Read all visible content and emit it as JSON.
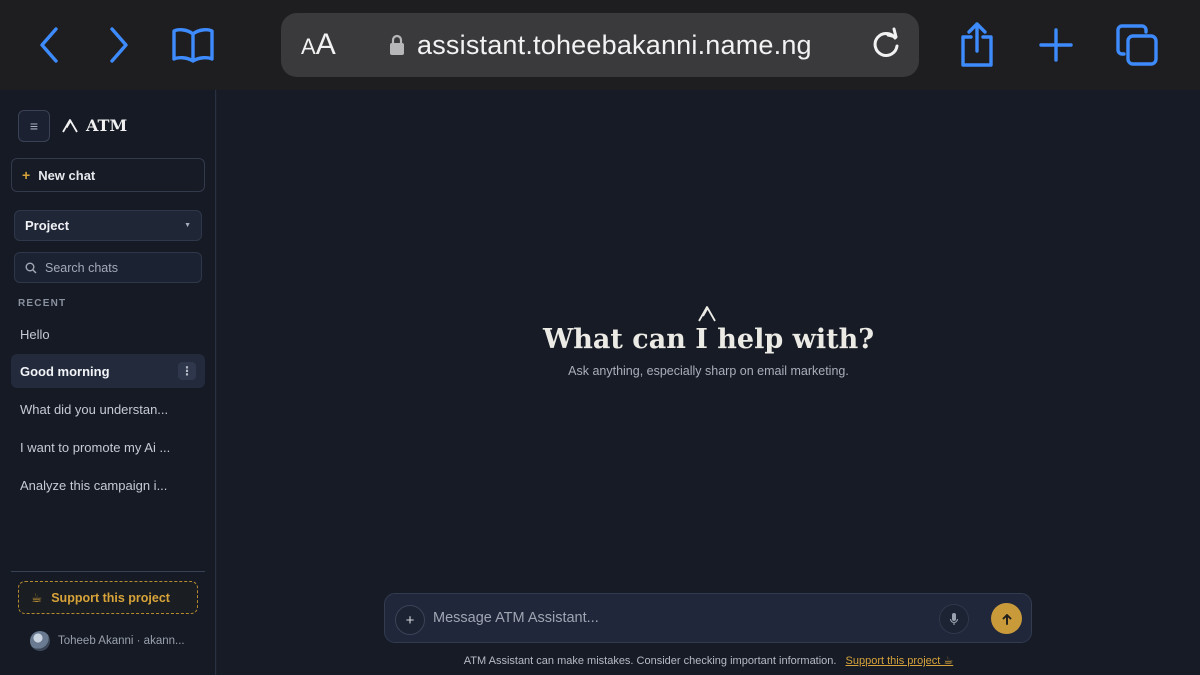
{
  "browser": {
    "text_size_label_small": "A",
    "text_size_label_large": "A",
    "url": "assistant.toheebakanni.name.ng",
    "icons": [
      "back-icon",
      "forward-icon",
      "bookmarks-icon",
      "lock-icon",
      "reload-icon",
      "share-icon",
      "new-tab-icon",
      "tabs-icon"
    ],
    "accent": "#3d8bfd"
  },
  "sidebar": {
    "brand": "ATM",
    "new_chat": "New chat",
    "project_select": "Project",
    "search_placeholder": "Search chats",
    "recent_label": "RECENT",
    "chats": [
      {
        "title": "Hello",
        "active": false
      },
      {
        "title": "Good morning",
        "active": true
      },
      {
        "title": "What did you understan...",
        "active": false
      },
      {
        "title": "I want to promote my Ai ...",
        "active": false
      },
      {
        "title": "Analyze this campaign i...",
        "active": false
      }
    ],
    "support": "Support this project",
    "user": "Toheeb Akanni · akann..."
  },
  "main": {
    "title": "What can I help with?",
    "subtitle": "Ask anything, especially sharp on email marketing.",
    "composer_placeholder": "Message ATM Assistant...",
    "disclaimer": "ATM Assistant can make mistakes. Consider checking important information.",
    "disclaimer_link": "Support this project ☕",
    "accent": "#c99a3a"
  }
}
